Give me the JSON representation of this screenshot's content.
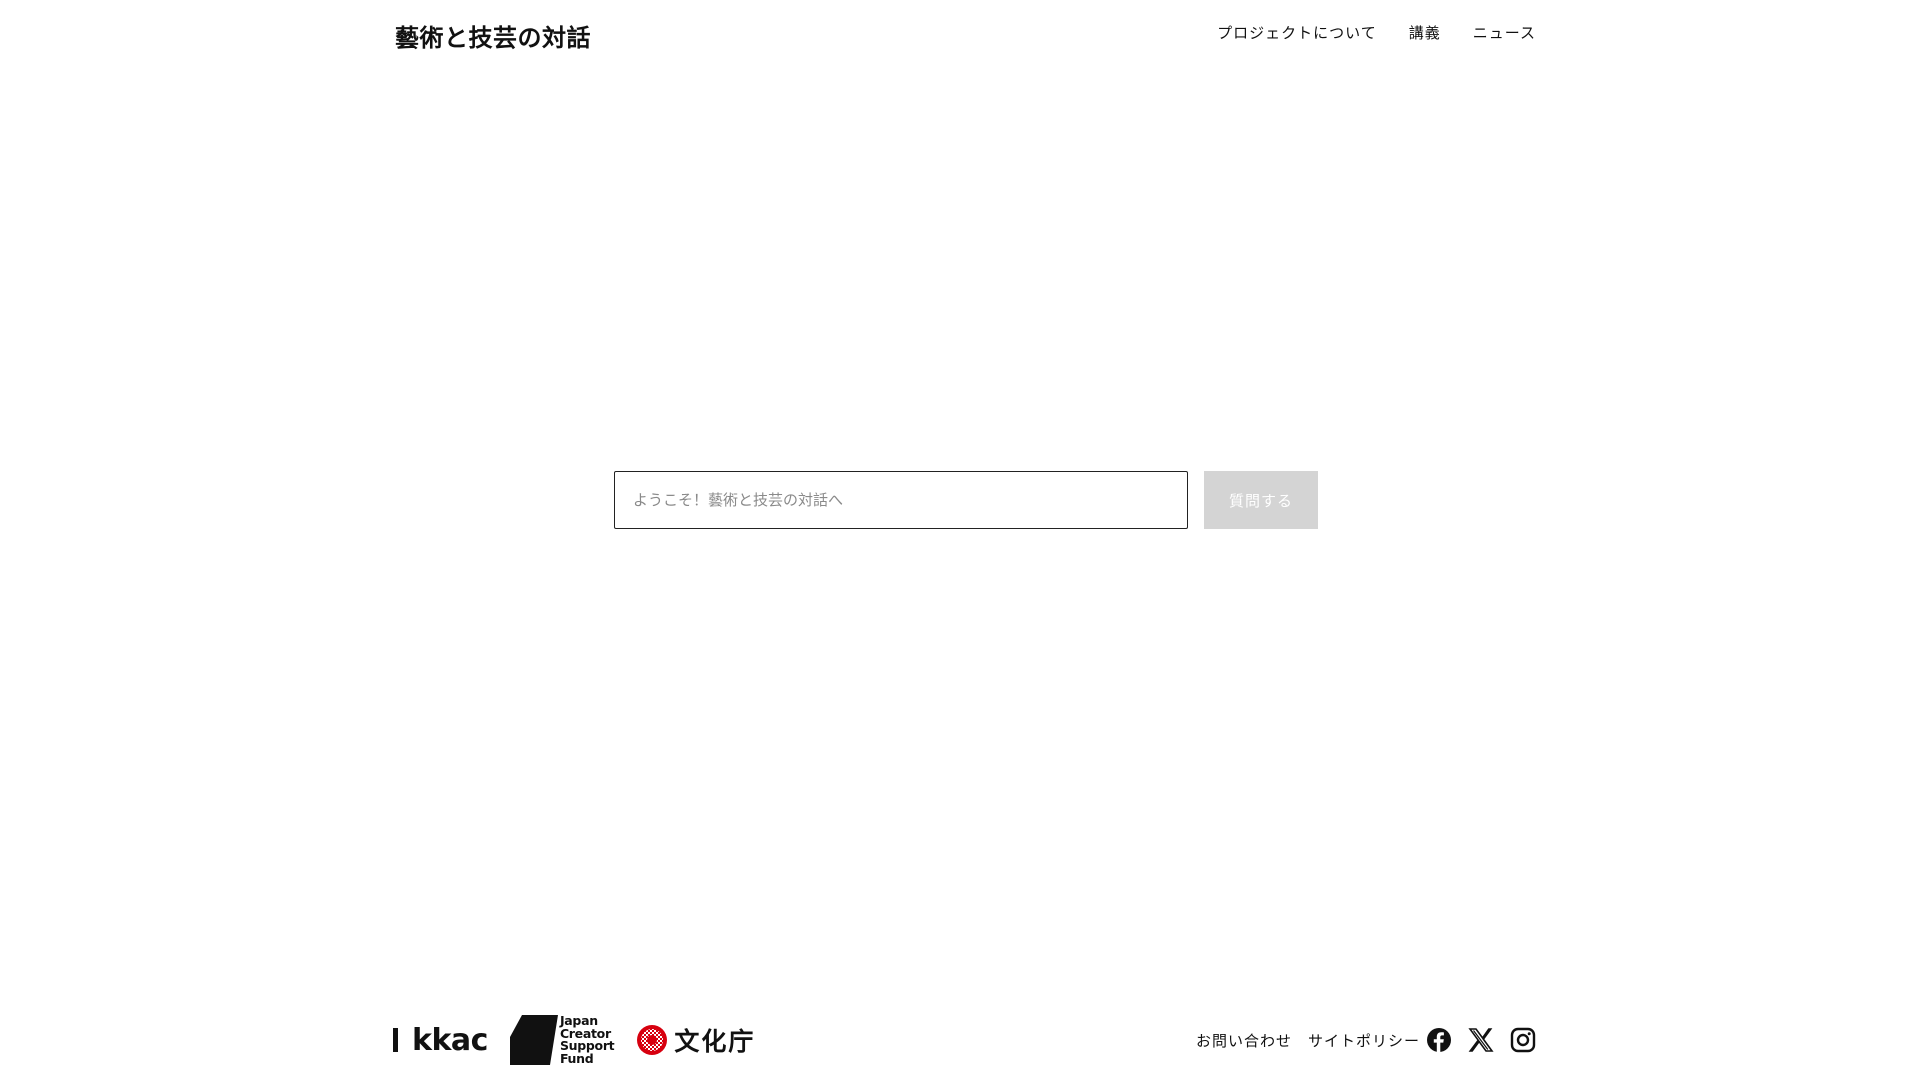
{
  "header": {
    "site_title": "藝術と技芸の対話",
    "nav": [
      {
        "label": "プロジェクトについて"
      },
      {
        "label": "講義"
      },
      {
        "label": "ニュース"
      }
    ]
  },
  "main": {
    "question_input": {
      "placeholder": "ようこそ！藝術と技芸の対話へ",
      "value": ""
    },
    "ask_button_label": "質問する"
  },
  "footer": {
    "logos": {
      "kkac": "kkac",
      "jcsf_lines": [
        "Japan",
        "Creator",
        "Support",
        "Fund"
      ],
      "bunka": "文化庁"
    },
    "links": [
      {
        "label": "お問い合わせ"
      },
      {
        "label": "サイトポリシー"
      }
    ],
    "social_icons": [
      "facebook-icon",
      "x-icon",
      "instagram-icon"
    ]
  },
  "colors": {
    "text": "#111111",
    "background": "#ffffff",
    "button_disabled_bg": "#d4d4d4",
    "bunka_red": "#d7000f"
  }
}
